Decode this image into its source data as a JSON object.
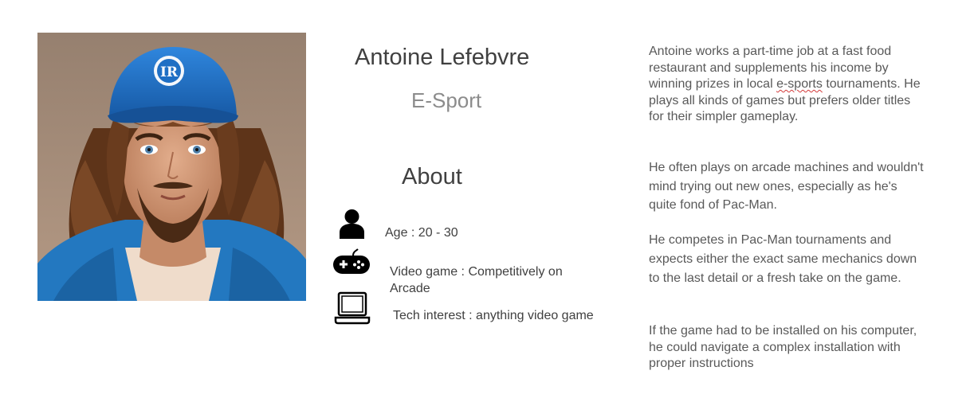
{
  "persona": {
    "name": "Antoine Lefebvre",
    "category": "E-Sport"
  },
  "about": {
    "heading": "About",
    "items": [
      {
        "icon": "person-icon",
        "text": "Age : 20 - 30"
      },
      {
        "icon": "gamepad-icon",
        "text": "Video game : Competitively on Arcade"
      },
      {
        "icon": "laptop-icon",
        "text": "Tech interest : anything video game"
      }
    ]
  },
  "bio": {
    "p1_before": "Antoine works a part-time job at a fast food restaurant and supplements his income by winning prizes in local ",
    "p1_flagged": "e-sports",
    "p1_after": " tournaments. He plays all kinds of games but prefers older titles for their simpler gameplay.",
    "p2": "He often plays on arcade machines and wouldn't mind trying out new ones, especially as he's quite fond of Pac-Man.",
    "p3": "He competes in Pac-Man tournaments and expects either the exact same mechanics down to the last detail or a fresh take on the game.",
    "p4": "If the game had to be installed on his computer, he could navigate a complex installation with proper instructions"
  },
  "portrait": {
    "cap_logo": "IR",
    "colors": {
      "background": "#a48a76",
      "cap": "#1f6fc4",
      "hoodie": "#2378c0",
      "skin": "#d7a07e",
      "hair": "#6a3c1e"
    }
  }
}
